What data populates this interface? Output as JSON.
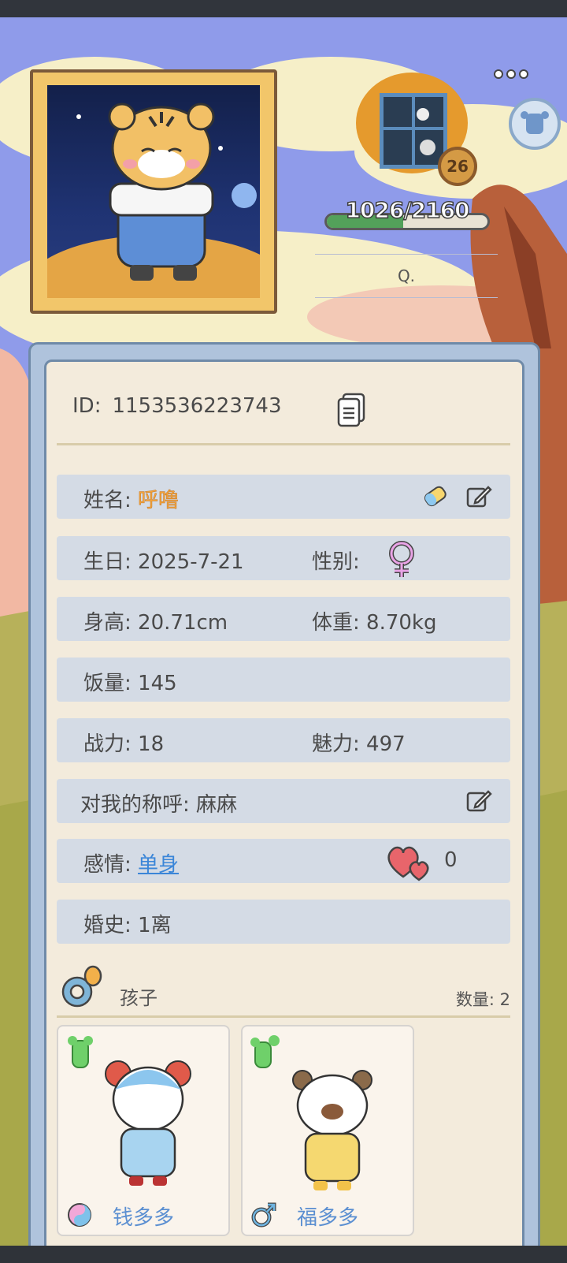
{
  "profile": {
    "level": "26",
    "exp": {
      "text": "1026/2160",
      "current": 1026,
      "max": 2160
    },
    "search_label": "Q.",
    "id_label": "ID:",
    "id_value": "1153536223743"
  },
  "info": {
    "name_label": "姓名:",
    "name_value": "呼噜",
    "birthday_label": "生日:",
    "birthday_value": "2025-7-21",
    "gender_label": "性别:",
    "gender_icon": "female-symbol-icon",
    "height_label": "身高:",
    "height_value": "20.71cm",
    "weight_label": "体重:",
    "weight_value": "8.70kg",
    "appetite_label": "饭量:",
    "appetite_value": "145",
    "power_label": "战力:",
    "power_value": "18",
    "charm_label": "魅力:",
    "charm_value": "497",
    "address_label": "对我的称呼:",
    "address_value": "麻麻",
    "relationship_label": "感情:",
    "relationship_value": "单身",
    "hearts_value": "0",
    "marriage_label": "婚史:",
    "marriage_value": "1离"
  },
  "children": {
    "title": "孩子",
    "count_text": "数量: 2",
    "items": [
      {
        "name": "钱多多",
        "gender_icon": "yin-yang-icon"
      },
      {
        "name": "福多多",
        "gender_icon": "male-symbol-icon"
      }
    ]
  },
  "colors": {
    "panel_bg": "#f3ebdc",
    "row_bg": "#d4dbe5",
    "accent_orange": "#f5a43a",
    "link_blue": "#3b86d8",
    "child_name_blue": "#5b8fd1"
  }
}
